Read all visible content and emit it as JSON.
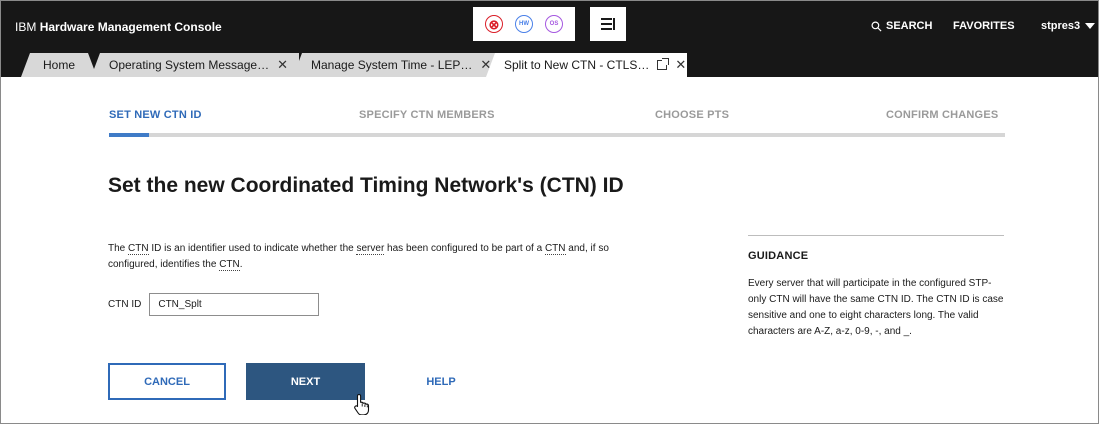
{
  "header": {
    "brand_prefix": "IBM",
    "brand_name": "Hardware Management Console",
    "status_icons": [
      {
        "name": "error-icon",
        "label": "⊗",
        "color": "#da1e28"
      },
      {
        "name": "hardware-status-icon",
        "label": "HW",
        "color": "#4a80e8"
      },
      {
        "name": "os-status-icon",
        "label": "OS",
        "color": "#a558e0"
      }
    ],
    "search_label": "SEARCH",
    "favorites_label": "FAVORITES",
    "user_name": "stpres3"
  },
  "tabs": [
    {
      "label": "Home",
      "closable": false,
      "popout": false,
      "active": false
    },
    {
      "label": "Operating System Message…",
      "closable": true,
      "popout": false,
      "active": false
    },
    {
      "label": "Manage System Time - LEP…",
      "closable": true,
      "popout": false,
      "active": false
    },
    {
      "label": "Split to New CTN - CTLS…",
      "closable": true,
      "popout": true,
      "active": true
    }
  ],
  "tab_close_glyph": "✕",
  "steps": {
    "items": [
      "SET NEW CTN ID",
      "SPECIFY CTN MEMBERS",
      "CHOOSE PTS",
      "CONFIRM CHANGES"
    ],
    "active_index": 0,
    "progress_fraction": 0.045
  },
  "content": {
    "title": "Set the new Coordinated Timing Network's (CTN) ID",
    "description": {
      "p1": "The ",
      "t1": "CTN",
      "p2": " ID is an identifier used to indicate whether the ",
      "t2": "server",
      "p3": " has been configured to be part of a ",
      "t3": "CTN",
      "p4": " and, if so configured, identifies the ",
      "t4": "CTN",
      "p5": "."
    },
    "field_label": "CTN ID",
    "field_value": "CTN_Splt"
  },
  "buttons": {
    "cancel": "CANCEL",
    "next": "NEXT",
    "help": "HELP"
  },
  "guidance": {
    "title": "GUIDANCE",
    "text": "Every server that will participate in the configured STP-only CTN will have the same CTN ID. The CTN ID is case sensitive and one to eight characters long. The valid characters are A-Z, a-z, 0-9, -, and _."
  },
  "colors": {
    "topbar": "#171717",
    "accent": "#2f6ab8",
    "primary_button": "#2d5680"
  }
}
